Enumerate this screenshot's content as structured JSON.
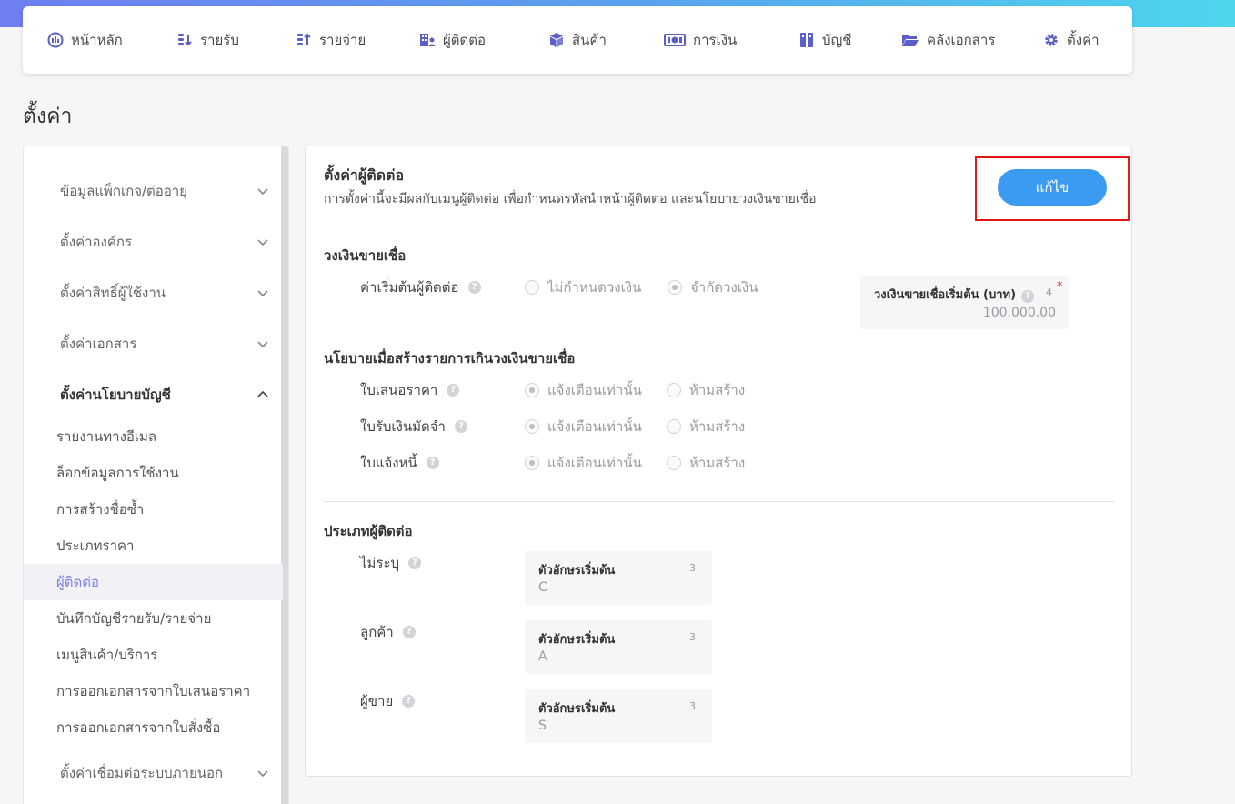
{
  "nav": [
    {
      "label": "หน้าหลัก",
      "icon": "gauge-icon"
    },
    {
      "label": "รายรับ",
      "icon": "coins-in-icon"
    },
    {
      "label": "รายจ่าย",
      "icon": "coins-out-icon"
    },
    {
      "label": "ผู้ติดต่อ",
      "icon": "contacts-icon"
    },
    {
      "label": "สินค้า",
      "icon": "box-icon"
    },
    {
      "label": "การเงิน",
      "icon": "money-icon"
    },
    {
      "label": "บัญชี",
      "icon": "ledger-icon"
    },
    {
      "label": "คลังเอกสาร",
      "icon": "folder-icon"
    },
    {
      "label": "ตั้งค่า",
      "icon": "gear-icon"
    }
  ],
  "page_title": "ตั้งค่า",
  "sidebar": {
    "groups": [
      {
        "label": "ข้อมูลแพ็กเกจ/ต่ออายุ",
        "open": false
      },
      {
        "label": "ตั้งค่าองค์กร",
        "open": false
      },
      {
        "label": "ตั้งค่าสิทธิ์ผู้ใช้งาน",
        "open": false
      },
      {
        "label": "ตั้งค่าเอกสาร",
        "open": false
      },
      {
        "label": "ตั้งค่านโยบายบัญชี",
        "open": true
      },
      {
        "label": "ตั้งค่าเชื่อมต่อระบบภายนอก",
        "open": false
      }
    ],
    "sub_items": [
      {
        "label": "รายงานทางอีเมล",
        "active": false
      },
      {
        "label": "ล็อกข้อมูลการใช้งาน",
        "active": false
      },
      {
        "label": "การสร้างชื่อซ้ำ",
        "active": false
      },
      {
        "label": "ประเภทราคา",
        "active": false
      },
      {
        "label": "ผู้ติดต่อ",
        "active": true
      },
      {
        "label": "บันทึกบัญชีรายรับ/รายจ่าย",
        "active": false
      },
      {
        "label": "เมนูสินค้า/บริการ",
        "active": false
      },
      {
        "label": "การออกเอกสารจากใบเสนอราคา",
        "active": false
      },
      {
        "label": "การออกเอกสารจากใบสั่งซื้อ",
        "active": false
      }
    ]
  },
  "panel": {
    "title": "ตั้งค่าผู้ติดต่อ",
    "description": "การตั้งค่านี้จะมีผลกับเมนูผู้ติดต่อ เพื่อกำหนดรหัสนำหน้าผู้ติดต่อ และนโยบายวงเงินขายเชื่อ",
    "edit_label": "แก้ไข",
    "credit": {
      "section_title": "วงเงินขายเชื่อ",
      "default_label": "ค่าเริ่มต้นผู้ติดต่อ",
      "options": [
        {
          "label": "ไม่กำหนดวงเงิน",
          "selected": false
        },
        {
          "label": "จำกัดวงเงิน",
          "selected": true
        }
      ],
      "limit_field": {
        "label": "วงเงินขายเชื่อเริ่มต้น (บาท)",
        "count": "4",
        "required": "*",
        "value": "100,000.00"
      }
    },
    "policy": {
      "section_title": "นโยบายเมื่อสร้างรายการเกินวงเงินขายเชื่อ",
      "option_warn": "แจ้งเตือนเท่านั้น",
      "option_block": "ห้ามสร้าง",
      "rows": [
        {
          "label": "ใบเสนอราคา"
        },
        {
          "label": "ใบรับเงินมัดจำ"
        },
        {
          "label": "ใบแจ้งหนี้"
        }
      ]
    },
    "contact_types": {
      "section_title": "ประเภทผู้ติดต่อ",
      "field_label": "ตัวอักษรเริ่มต้น",
      "rows": [
        {
          "label": "ไม่ระบุ",
          "count": "3",
          "value": "C"
        },
        {
          "label": "ลูกค้า",
          "count": "3",
          "value": "A"
        },
        {
          "label": "ผู้ขาย",
          "count": "3",
          "value": "S"
        }
      ]
    }
  }
}
